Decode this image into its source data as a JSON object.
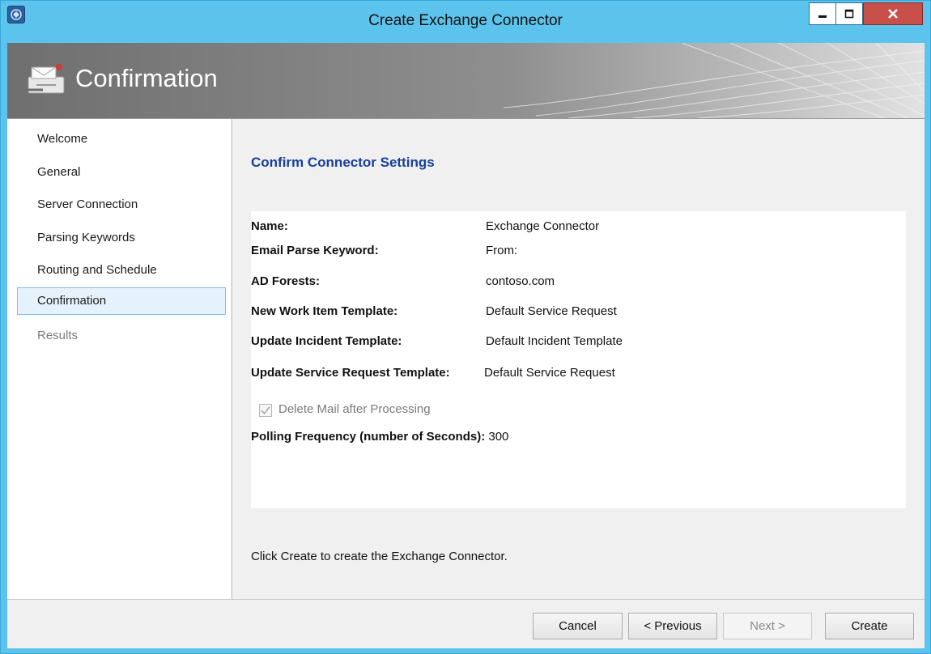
{
  "window": {
    "title": "Create Exchange Connector"
  },
  "banner": {
    "title": "Confirmation"
  },
  "nav": {
    "items": [
      {
        "label": "Welcome"
      },
      {
        "label": "General"
      },
      {
        "label": "Server Connection"
      },
      {
        "label": "Parsing Keywords"
      },
      {
        "label": "Routing and Schedule"
      },
      {
        "label": "Confirmation"
      },
      {
        "label": "Results"
      }
    ]
  },
  "main": {
    "section_title": "Confirm Connector Settings",
    "settings": [
      {
        "label": "Name:",
        "value": "Exchange Connector"
      },
      {
        "label": "Email Parse Keyword:",
        "value": "From:"
      },
      {
        "label": "AD Forests:",
        "value": "contoso.com"
      },
      {
        "label": "New Work Item Template:",
        "value": "Default Service Request"
      },
      {
        "label": "Update Incident Template:",
        "value": "Default Incident Template"
      },
      {
        "label": "Update Service Request Template:",
        "value": "Default Service Request"
      }
    ],
    "delete_mail": {
      "label": "Delete Mail after Processing",
      "checked": true
    },
    "polling": {
      "label": "Polling Frequency (number of Seconds):",
      "value": "300"
    },
    "footer_note": "Click Create to create the Exchange Connector."
  },
  "buttons": {
    "cancel": "Cancel",
    "previous": "< Previous",
    "next": "Next >",
    "create": "Create"
  },
  "colors": {
    "window_frame": "#5cc4ec",
    "section_title": "#173f9c",
    "selected_nav_bg": "#e5f1fb",
    "close_button": "#c7504b"
  }
}
